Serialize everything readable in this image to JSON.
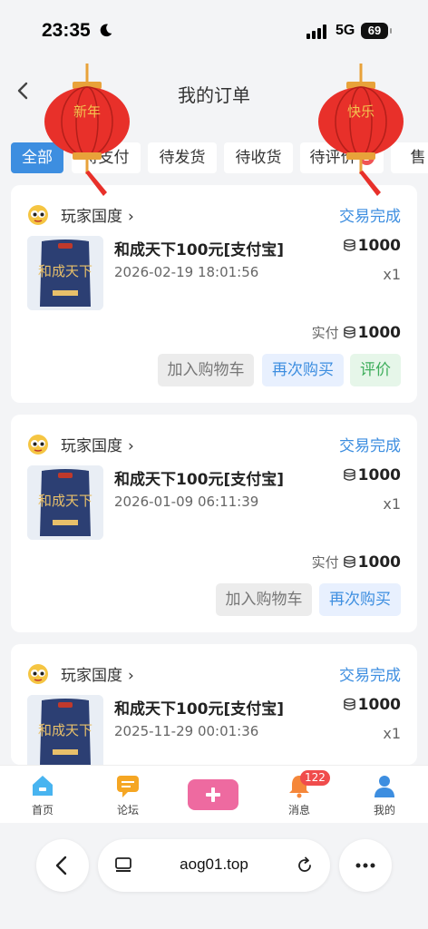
{
  "status_bar": {
    "time": "23:35",
    "network": "5G",
    "battery": "69"
  },
  "header": {
    "title": "我的订单"
  },
  "lanterns": {
    "left_text": "新年",
    "right_text": "快乐"
  },
  "tabs": [
    {
      "label": "全部",
      "active": true
    },
    {
      "label": "待支付"
    },
    {
      "label": "待发货"
    },
    {
      "label": "待收货"
    },
    {
      "label": "待评价",
      "badge": "1"
    },
    {
      "label": "售"
    }
  ],
  "orders": [
    {
      "shop": "玩家国度",
      "status": "交易完成",
      "product": "和成天下100元[支付宝]",
      "price": "1000",
      "date": "2026-02-19 18:01:56",
      "qty": "x1",
      "paid_label": "实付",
      "paid": "1000",
      "actions": [
        "加入购物车",
        "再次购买",
        "评价"
      ]
    },
    {
      "shop": "玩家国度",
      "status": "交易完成",
      "product": "和成天下100元[支付宝]",
      "price": "1000",
      "date": "2026-01-09 06:11:39",
      "qty": "x1",
      "paid_label": "实付",
      "paid": "1000",
      "actions": [
        "加入购物车",
        "再次购买"
      ]
    },
    {
      "shop": "玩家国度",
      "status": "交易完成",
      "product": "和成天下100元[支付宝]",
      "price": "1000",
      "date": "2025-11-29 00:01:36",
      "qty": "x1"
    }
  ],
  "product_image_text": "和成天下",
  "tabbar": [
    {
      "label": "首页",
      "icon": "home-icon"
    },
    {
      "label": "论坛",
      "icon": "forum-icon"
    },
    {
      "label": "",
      "icon": "plus-icon"
    },
    {
      "label": "消息",
      "icon": "bell-icon",
      "badge": "122"
    },
    {
      "label": "我的",
      "icon": "user-icon"
    }
  ],
  "browser": {
    "url": "aog01.top"
  },
  "colors": {
    "accent": "#3d8ee0",
    "badge": "#f05454",
    "lantern": "#e8302a"
  }
}
